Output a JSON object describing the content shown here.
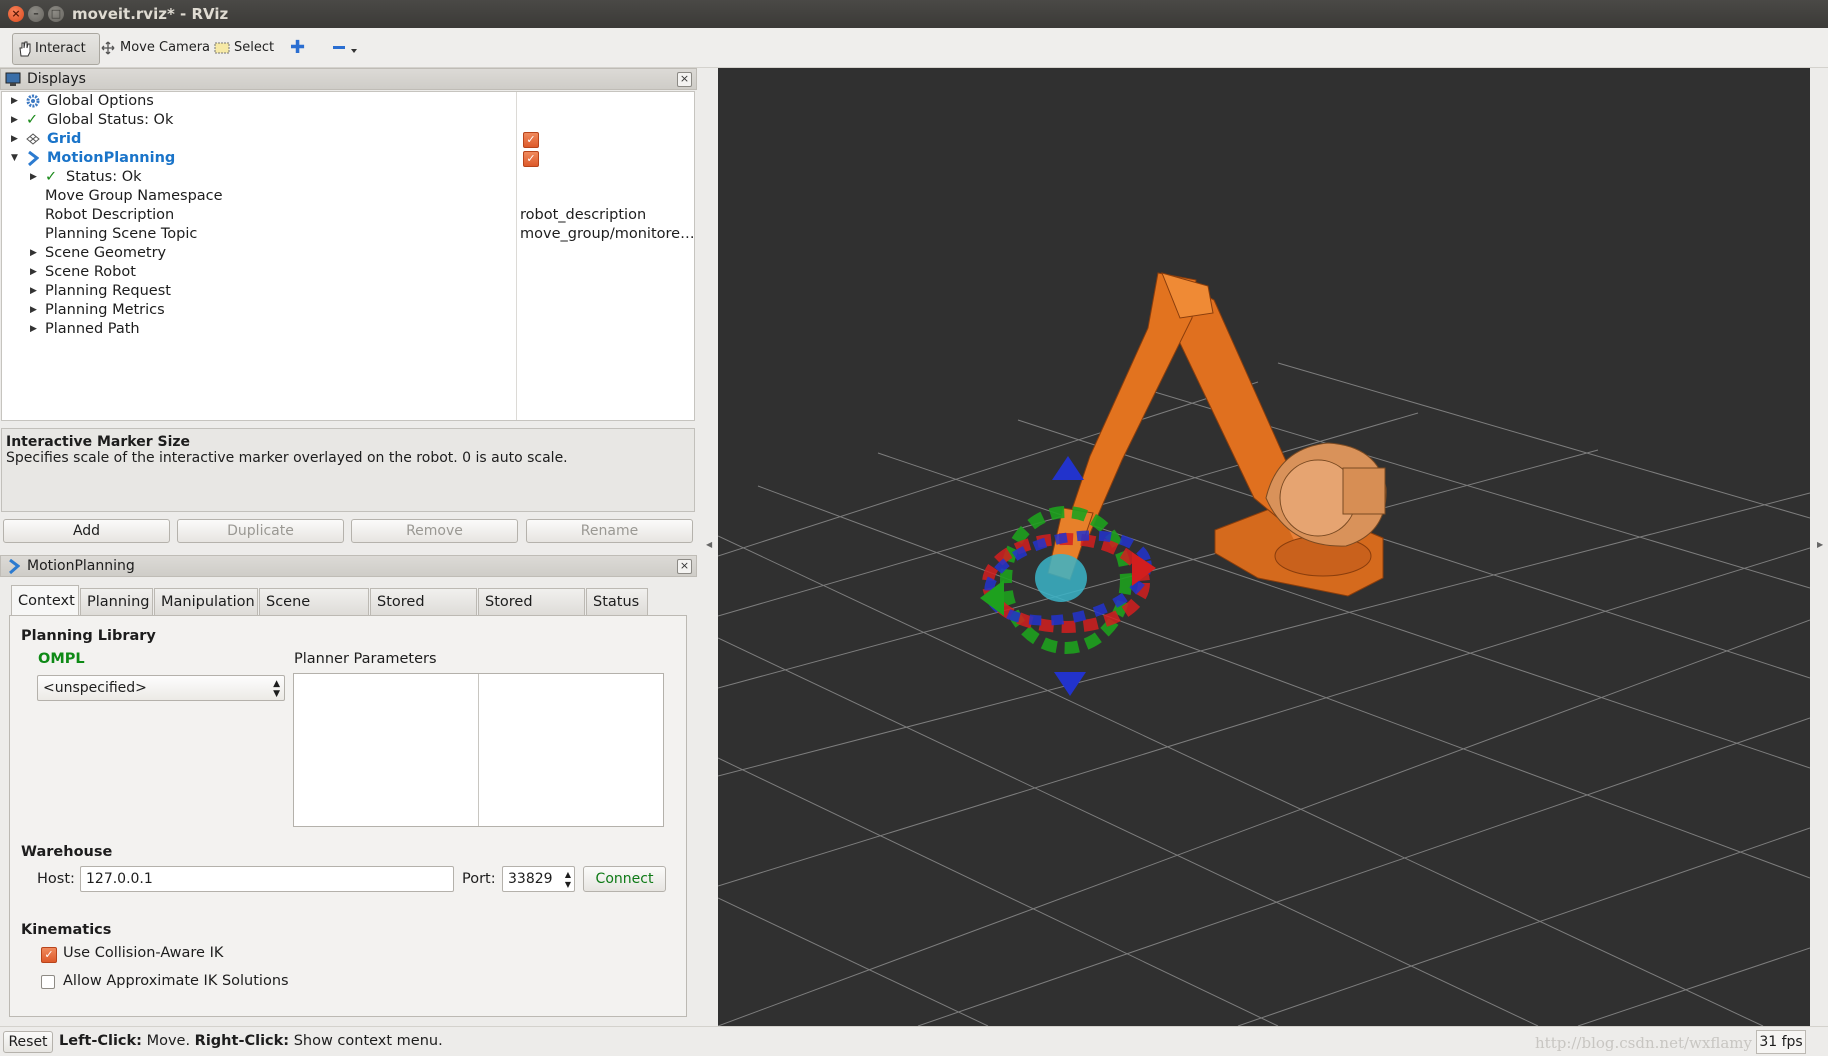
{
  "window": {
    "title": "moveit.rviz* - RViz"
  },
  "toolbar": {
    "interact": "Interact",
    "move_camera": "Move Camera",
    "select": "Select"
  },
  "displays": {
    "title": "Displays",
    "items": [
      {
        "label": "Global Options",
        "icon": "gear-icon"
      },
      {
        "label": "Global Status: Ok",
        "icon": "check-icon"
      },
      {
        "label": "Grid",
        "icon": "grid-icon",
        "checked": true
      },
      {
        "label": "MotionPlanning",
        "icon": "motion-planning-icon",
        "checked": true
      },
      {
        "label": "Status: Ok",
        "icon": "check-icon"
      },
      {
        "label": "Move Group Namespace"
      },
      {
        "label": "Robot Description",
        "value": "robot_description"
      },
      {
        "label": "Planning Scene Topic",
        "value": "move_group/monitore…"
      },
      {
        "label": "Scene Geometry"
      },
      {
        "label": "Scene Robot"
      },
      {
        "label": "Planning Request"
      },
      {
        "label": "Planning Metrics"
      },
      {
        "label": "Planned Path"
      }
    ]
  },
  "description": {
    "title": "Interactive Marker Size",
    "text": "Specifies scale of the interactive marker overlayed on the robot. 0 is auto scale."
  },
  "display_buttons": {
    "add": "Add",
    "duplicate": "Duplicate",
    "remove": "Remove",
    "rename": "Rename"
  },
  "motion_panel": {
    "title": "MotionPlanning",
    "tabs": [
      "Context",
      "Planning",
      "Manipulation",
      "Scene Objects",
      "Stored Scenes",
      "Stored States",
      "Status"
    ],
    "planning_library": {
      "heading": "Planning Library",
      "library": "OMPL",
      "planner": "<unspecified>",
      "params_label": "Planner Parameters"
    },
    "warehouse": {
      "heading": "Warehouse",
      "host_label": "Host:",
      "host": "127.0.0.1",
      "port_label": "Port:",
      "port": "33829",
      "connect": "Connect"
    },
    "kinematics": {
      "heading": "Kinematics",
      "collision_aware": "Use Collision-Aware IK",
      "collision_aware_checked": true,
      "approx": "Allow Approximate IK Solutions",
      "approx_checked": false
    }
  },
  "statusbar": {
    "reset": "Reset",
    "left_click": "Left-Click:",
    "left_action": "Move.",
    "right_click": "Right-Click:",
    "right_action": "Show context menu.",
    "watermark": "http://blog.csdn.net/wxflamy",
    "fps": "31 fps"
  },
  "colors": {
    "accent_blue": "#1a74c9",
    "ompl_green": "#0e8a16",
    "checkbox_orange": "#e0612f",
    "robot_orange": "#e2731f",
    "viewport_bg": "#303030"
  }
}
